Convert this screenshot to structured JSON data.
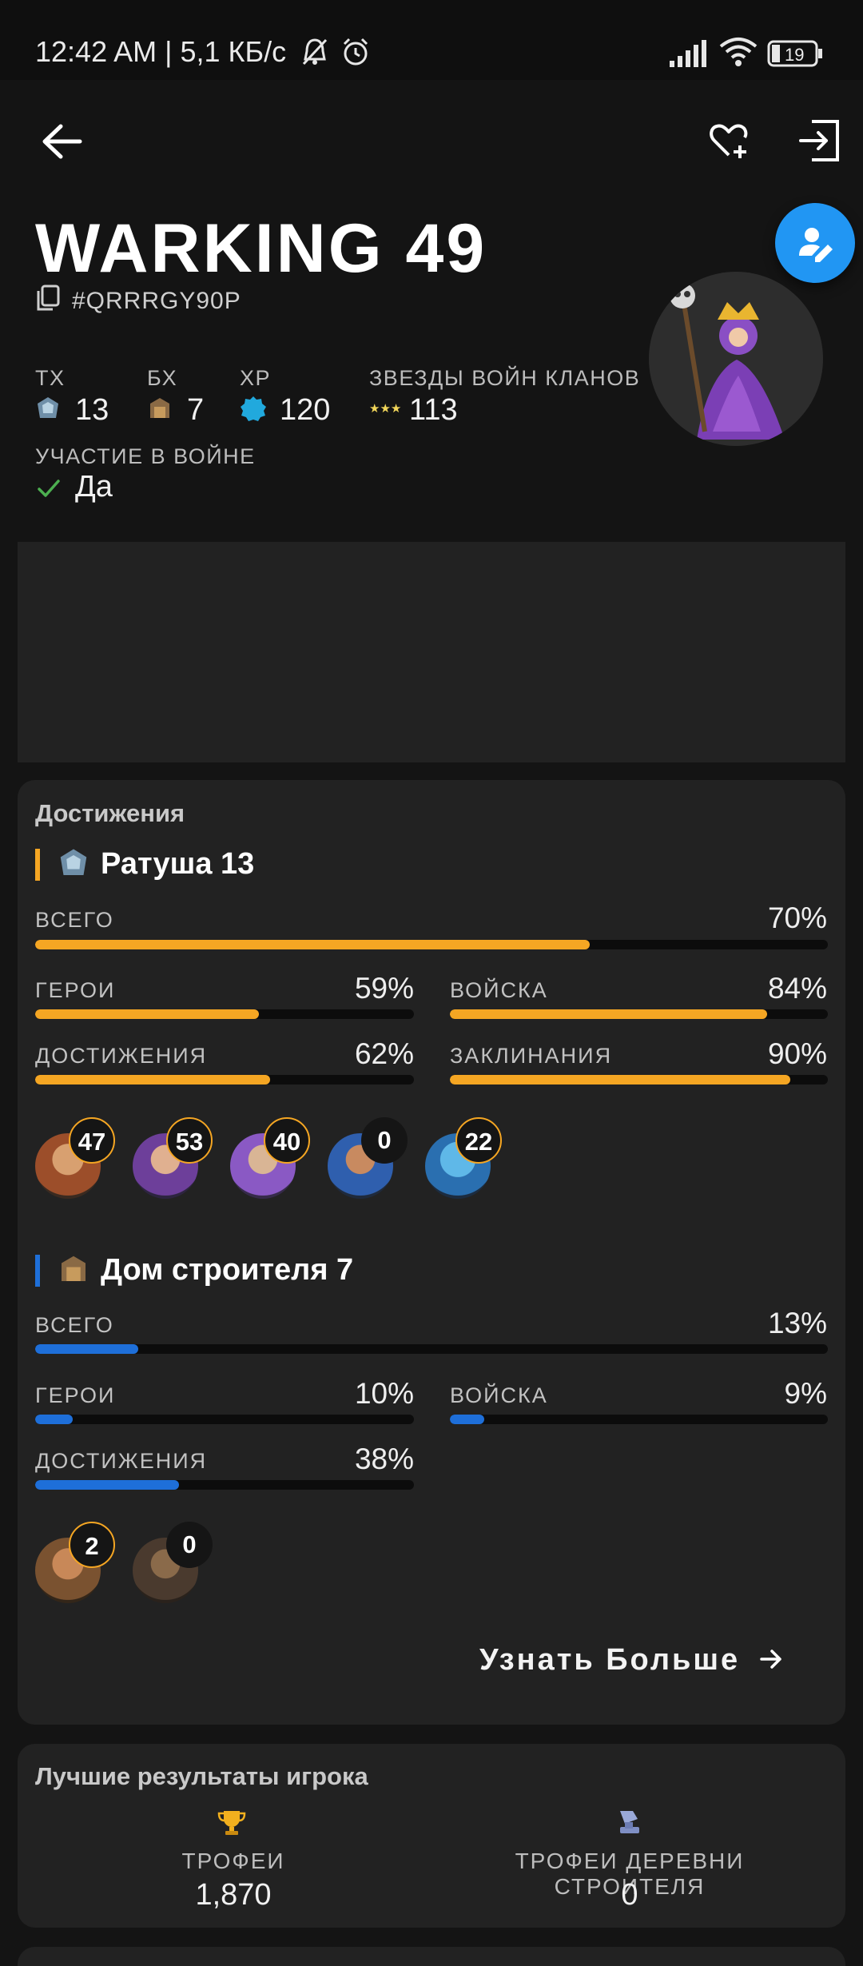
{
  "status_bar": {
    "time": "12:42 AM | 5,1 КБ/с",
    "battery_level": "19",
    "icons": [
      "mute-bell-icon",
      "alarm-icon",
      "signal-icon",
      "wifi-icon",
      "battery-icon"
    ]
  },
  "toolbar": {
    "back_icon": "arrow-left-icon",
    "favorite_icon": "heart-plus-icon",
    "exit_icon": "logout-icon"
  },
  "player": {
    "name": "WARKING 49",
    "tag": "#QRRRGY90P",
    "avatar_icon": "archer-queen-avatar"
  },
  "stats": [
    {
      "label": "ТХ",
      "value": "13",
      "icon": "town-hall-icon"
    },
    {
      "label": "БХ",
      "value": "7",
      "icon": "builder-hall-icon"
    },
    {
      "label": "XP",
      "value": "120",
      "icon": "xp-badge-icon"
    },
    {
      "label": "ЗВЕЗДЫ ВОЙН КЛАНОВ",
      "value": "113",
      "icon": "war-stars-icon"
    }
  ],
  "war": {
    "label": "УЧАСТИЕ В ВОЙНЕ",
    "value": "Да"
  },
  "achievements": {
    "title": "Достижения",
    "home": {
      "title": "Ратуша 13",
      "accent": "#f5a623",
      "rows": [
        {
          "label": "ВСЕГО",
          "percent": "70%",
          "value": 70
        },
        {
          "label": "ГЕРОИ",
          "percent": "59%",
          "value": 59
        },
        {
          "label": "ВОЙСКА",
          "percent": "84%",
          "value": 84
        },
        {
          "label": "ДОСТИЖЕНИЯ",
          "percent": "62%",
          "value": 62
        },
        {
          "label": "ЗАКЛИНАНИЯ",
          "percent": "90%",
          "value": 90
        }
      ],
      "heroes": [
        {
          "name": "barbarian-king",
          "level": "47"
        },
        {
          "name": "archer-queen",
          "level": "53"
        },
        {
          "name": "grand-warden",
          "level": "40"
        },
        {
          "name": "royal-champion",
          "level": "0"
        },
        {
          "name": "minion-prince",
          "level": "22"
        }
      ]
    },
    "builder": {
      "title": "Дом строителя 7",
      "accent": "#1e6fd9",
      "rows": [
        {
          "label": "ВСЕГО",
          "percent": "13%",
          "value": 13
        },
        {
          "label": "ГЕРОИ",
          "percent": "10%",
          "value": 10
        },
        {
          "label": "ВОЙСКА",
          "percent": "9%",
          "value": 9
        },
        {
          "label": "ДОСТИЖЕНИЯ",
          "percent": "38%",
          "value": 38
        }
      ],
      "heroes": [
        {
          "name": "battle-machine",
          "level": "2"
        },
        {
          "name": "battle-copter",
          "level": "0"
        }
      ]
    },
    "more_label": "Узнать Больше"
  },
  "best": {
    "title": "Лучшие результаты игрока",
    "items": [
      {
        "label": "ТРОФЕИ",
        "value": "1,870",
        "icon": "trophy-icon"
      },
      {
        "label": "ТРОФЕИ ДЕРЕВНИ СТРОИТЕЛЯ",
        "value": "0",
        "icon": "builder-trophy-icon"
      }
    ]
  },
  "colors": {
    "background": "#141414",
    "card": "#222222",
    "fab": "#2196f3",
    "gold": "#f5a623",
    "blue": "#1e6fd9",
    "check": "#4caf50"
  }
}
